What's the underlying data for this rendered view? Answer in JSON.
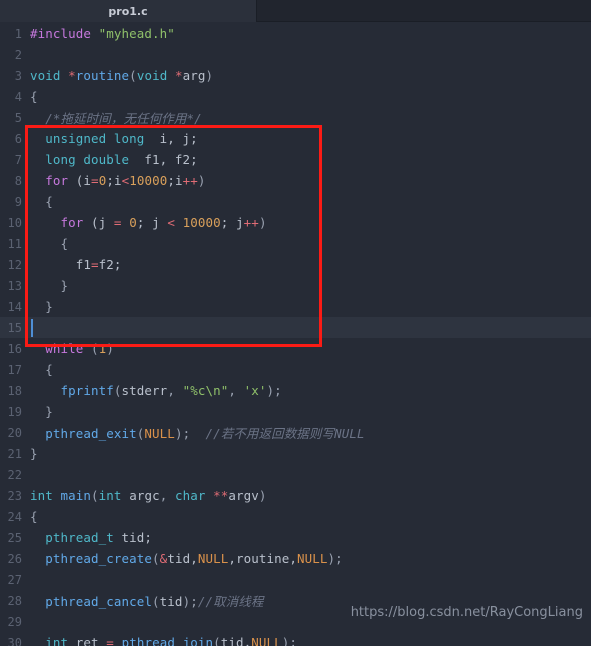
{
  "window": {
    "tab_label": "pro1.c"
  },
  "editor": {
    "current_line": 15,
    "colors": {
      "background": "#262b36",
      "current_line_bg": "#2e3440",
      "gutter_text": "#5b6272",
      "text": "#b9c0cc",
      "preprocessor": "#c678dd",
      "string": "#8fc06a",
      "type": "#4fb8c9",
      "function": "#61a9e8",
      "keyword": "#c678dd",
      "number": "#d9a05b",
      "constant": "#d9914b",
      "operator": "#e06c75",
      "comment": "#6b7386",
      "annotation_rect": "#fb1b15",
      "caret": "#4f8fd6"
    },
    "lines": [
      {
        "n": "1",
        "tokens": [
          {
            "t": "#include ",
            "c": "k-pre"
          },
          {
            "t": "\"myhead.h\"",
            "c": "k-str"
          }
        ]
      },
      {
        "n": "2",
        "tokens": []
      },
      {
        "n": "3",
        "tokens": [
          {
            "t": "void ",
            "c": "k-type"
          },
          {
            "t": "*",
            "c": "k-op"
          },
          {
            "t": "routine",
            "c": "k-fn"
          },
          {
            "t": "(",
            "c": "k-punc"
          },
          {
            "t": "void ",
            "c": "k-type"
          },
          {
            "t": "*",
            "c": "k-op"
          },
          {
            "t": "arg",
            "c": "k-var"
          },
          {
            "t": ")",
            "c": "k-punc"
          }
        ]
      },
      {
        "n": "4",
        "tokens": [
          {
            "t": "{",
            "c": "k-punc"
          }
        ]
      },
      {
        "n": "5",
        "tokens": [
          {
            "t": "  /*拖延时间，无任何作用*/",
            "c": "k-cmt"
          }
        ]
      },
      {
        "n": "6",
        "tokens": [
          {
            "t": "  ",
            "c": "k-var"
          },
          {
            "t": "unsigned long",
            "c": "k-type"
          },
          {
            "t": "  i, j;",
            "c": "k-var"
          }
        ]
      },
      {
        "n": "7",
        "tokens": [
          {
            "t": "  ",
            "c": "k-var"
          },
          {
            "t": "long double",
            "c": "k-type"
          },
          {
            "t": "  f1, f2;",
            "c": "k-var"
          }
        ]
      },
      {
        "n": "8",
        "tokens": [
          {
            "t": "  ",
            "c": "k-var"
          },
          {
            "t": "for",
            "c": "k-kw"
          },
          {
            "t": " (i",
            "c": "k-var"
          },
          {
            "t": "=",
            "c": "k-op"
          },
          {
            "t": "0",
            "c": "k-num"
          },
          {
            "t": ";i",
            "c": "k-var"
          },
          {
            "t": "<",
            "c": "k-op"
          },
          {
            "t": "10000",
            "c": "k-num"
          },
          {
            "t": ";i",
            "c": "k-var"
          },
          {
            "t": "++",
            "c": "k-op"
          },
          {
            "t": ")",
            "c": "k-punc"
          }
        ]
      },
      {
        "n": "9",
        "tokens": [
          {
            "t": "  {",
            "c": "k-punc"
          }
        ]
      },
      {
        "n": "10",
        "tokens": [
          {
            "t": "    ",
            "c": "k-var"
          },
          {
            "t": "for",
            "c": "k-kw"
          },
          {
            "t": " (j ",
            "c": "k-var"
          },
          {
            "t": "=",
            "c": "k-op"
          },
          {
            "t": " ",
            "c": "k-var"
          },
          {
            "t": "0",
            "c": "k-num"
          },
          {
            "t": "; j ",
            "c": "k-var"
          },
          {
            "t": "<",
            "c": "k-op"
          },
          {
            "t": " ",
            "c": "k-var"
          },
          {
            "t": "10000",
            "c": "k-num"
          },
          {
            "t": "; j",
            "c": "k-var"
          },
          {
            "t": "++",
            "c": "k-op"
          },
          {
            "t": ")",
            "c": "k-punc"
          }
        ]
      },
      {
        "n": "11",
        "tokens": [
          {
            "t": "    {",
            "c": "k-punc"
          }
        ]
      },
      {
        "n": "12",
        "tokens": [
          {
            "t": "      f1",
            "c": "k-var"
          },
          {
            "t": "=",
            "c": "k-op"
          },
          {
            "t": "f2;",
            "c": "k-var"
          }
        ]
      },
      {
        "n": "13",
        "tokens": [
          {
            "t": "    }",
            "c": "k-punc"
          }
        ]
      },
      {
        "n": "14",
        "tokens": [
          {
            "t": "  }",
            "c": "k-punc"
          }
        ]
      },
      {
        "n": "15",
        "tokens": []
      },
      {
        "n": "16",
        "tokens": [
          {
            "t": "  ",
            "c": "k-var"
          },
          {
            "t": "while",
            "c": "k-kw"
          },
          {
            "t": " (",
            "c": "k-punc"
          },
          {
            "t": "1",
            "c": "k-num"
          },
          {
            "t": ")",
            "c": "k-punc"
          }
        ]
      },
      {
        "n": "17",
        "tokens": [
          {
            "t": "  {",
            "c": "k-punc"
          }
        ]
      },
      {
        "n": "18",
        "tokens": [
          {
            "t": "    ",
            "c": "k-var"
          },
          {
            "t": "fprintf",
            "c": "k-fn"
          },
          {
            "t": "(",
            "c": "k-punc"
          },
          {
            "t": "stderr",
            "c": "k-var"
          },
          {
            "t": ", ",
            "c": "k-punc"
          },
          {
            "t": "\"%c\\n\"",
            "c": "k-str"
          },
          {
            "t": ", ",
            "c": "k-punc"
          },
          {
            "t": "'x'",
            "c": "k-str"
          },
          {
            "t": ");",
            "c": "k-punc"
          }
        ]
      },
      {
        "n": "19",
        "tokens": [
          {
            "t": "  }",
            "c": "k-punc"
          }
        ]
      },
      {
        "n": "20",
        "tokens": [
          {
            "t": "  ",
            "c": "k-var"
          },
          {
            "t": "pthread_exit",
            "c": "k-fn"
          },
          {
            "t": "(",
            "c": "k-punc"
          },
          {
            "t": "NULL",
            "c": "k-const"
          },
          {
            "t": ");  ",
            "c": "k-punc"
          },
          {
            "t": "//若不用返回数据则写NULL",
            "c": "k-cmt"
          }
        ]
      },
      {
        "n": "21",
        "tokens": [
          {
            "t": "}",
            "c": "k-punc"
          }
        ]
      },
      {
        "n": "22",
        "tokens": []
      },
      {
        "n": "23",
        "tokens": [
          {
            "t": "int ",
            "c": "k-type"
          },
          {
            "t": "main",
            "c": "k-fn"
          },
          {
            "t": "(",
            "c": "k-punc"
          },
          {
            "t": "int ",
            "c": "k-type"
          },
          {
            "t": "argc",
            "c": "k-var"
          },
          {
            "t": ", ",
            "c": "k-punc"
          },
          {
            "t": "char ",
            "c": "k-type"
          },
          {
            "t": "**",
            "c": "k-op"
          },
          {
            "t": "argv",
            "c": "k-var"
          },
          {
            "t": ")",
            "c": "k-punc"
          }
        ]
      },
      {
        "n": "24",
        "tokens": [
          {
            "t": "{",
            "c": "k-punc"
          }
        ]
      },
      {
        "n": "25",
        "tokens": [
          {
            "t": "  ",
            "c": "k-var"
          },
          {
            "t": "pthread_t",
            "c": "k-type"
          },
          {
            "t": " tid;",
            "c": "k-var"
          }
        ]
      },
      {
        "n": "26",
        "tokens": [
          {
            "t": "  ",
            "c": "k-var"
          },
          {
            "t": "pthread_create",
            "c": "k-fn"
          },
          {
            "t": "(",
            "c": "k-punc"
          },
          {
            "t": "&",
            "c": "k-op"
          },
          {
            "t": "tid,",
            "c": "k-var"
          },
          {
            "t": "NULL",
            "c": "k-const"
          },
          {
            "t": ",routine,",
            "c": "k-var"
          },
          {
            "t": "NULL",
            "c": "k-const"
          },
          {
            "t": ");",
            "c": "k-punc"
          }
        ]
      },
      {
        "n": "27",
        "tokens": []
      },
      {
        "n": "28",
        "tokens": [
          {
            "t": "  ",
            "c": "k-var"
          },
          {
            "t": "pthread_cancel",
            "c": "k-fn"
          },
          {
            "t": "(",
            "c": "k-punc"
          },
          {
            "t": "tid",
            "c": "k-var"
          },
          {
            "t": ");",
            "c": "k-punc"
          },
          {
            "t": "//取消线程",
            "c": "k-cmt"
          }
        ]
      },
      {
        "n": "29",
        "tokens": []
      },
      {
        "n": "30",
        "tokens": [
          {
            "t": "  ",
            "c": "k-var"
          },
          {
            "t": "int ",
            "c": "k-type"
          },
          {
            "t": "ret ",
            "c": "k-var"
          },
          {
            "t": "=",
            "c": "k-op"
          },
          {
            "t": " ",
            "c": "k-var"
          },
          {
            "t": "pthread_join",
            "c": "k-fn"
          },
          {
            "t": "(",
            "c": "k-punc"
          },
          {
            "t": "tid,",
            "c": "k-var"
          },
          {
            "t": "NULL",
            "c": "k-const"
          },
          {
            "t": ");",
            "c": "k-punc"
          }
        ]
      }
    ]
  },
  "watermark": {
    "url": "https://blog.csdn.net/RayCongLiang"
  }
}
